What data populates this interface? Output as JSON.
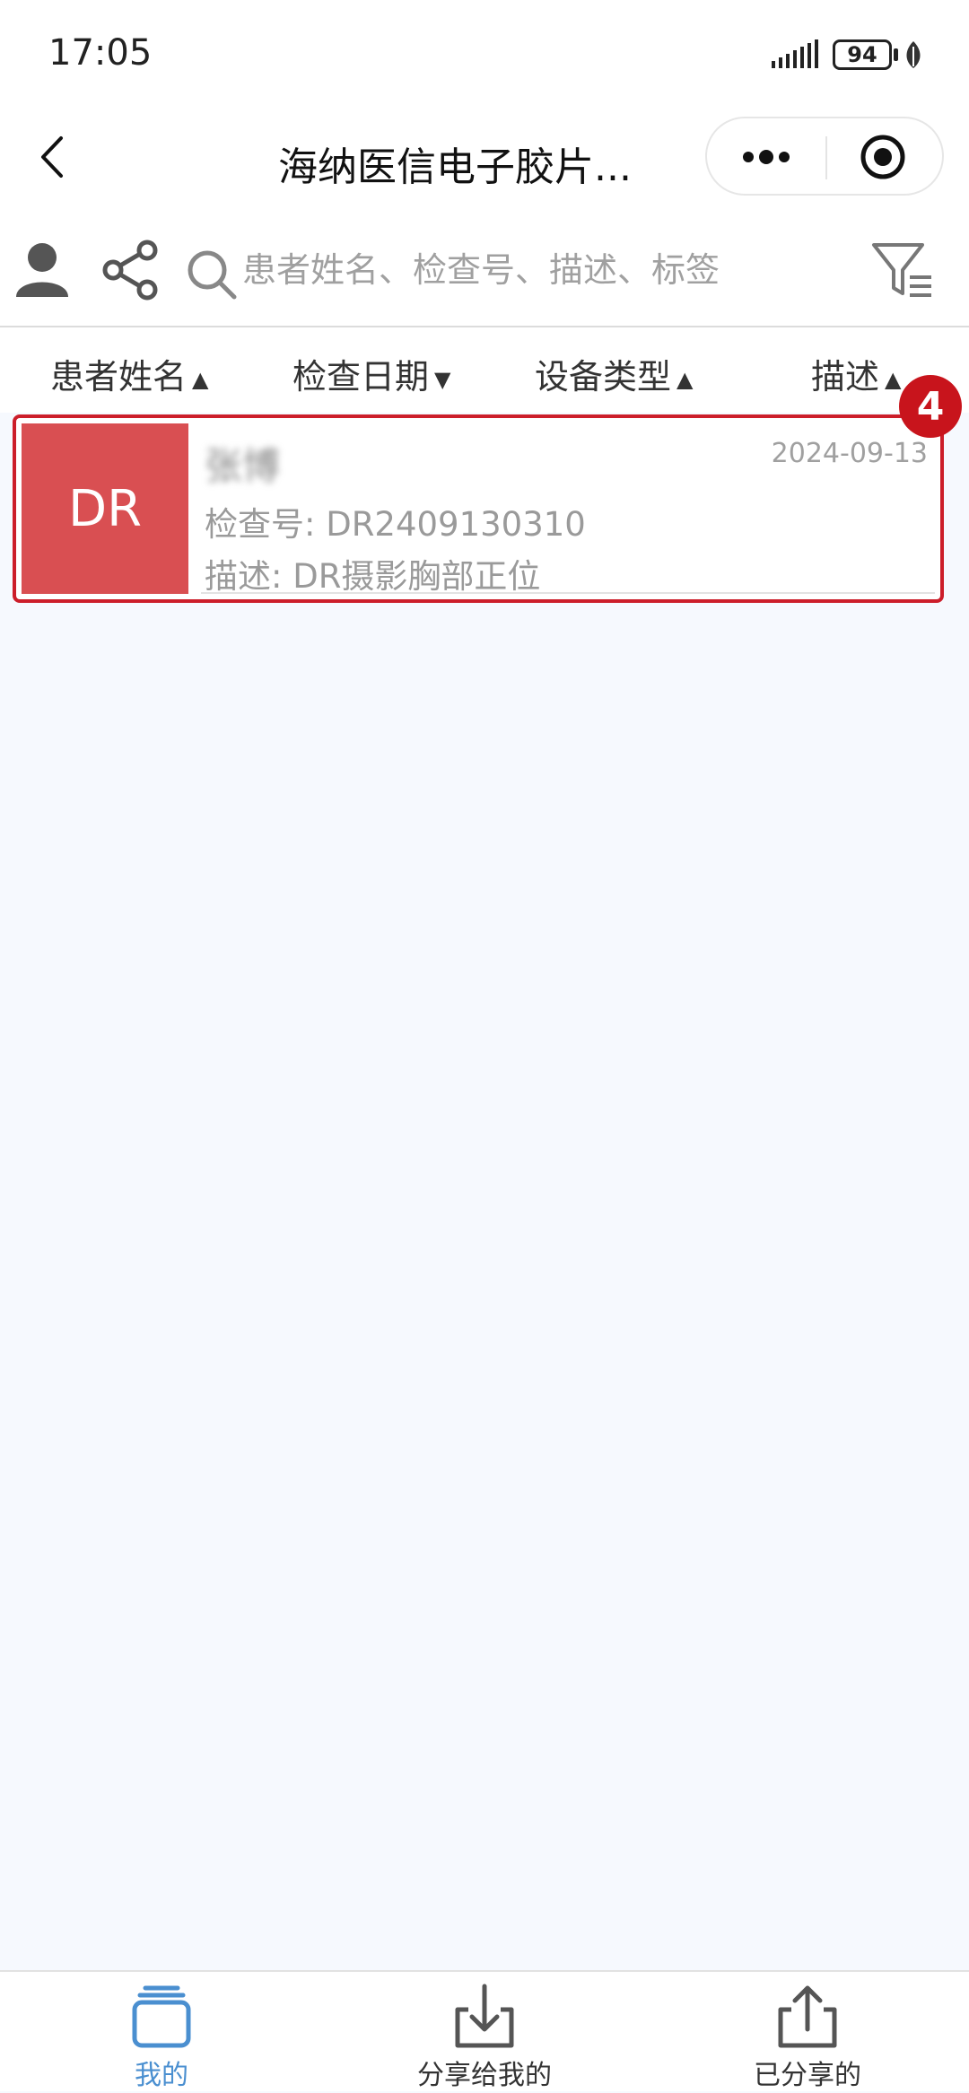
{
  "status_bar": {
    "time": "17:05",
    "battery": "94"
  },
  "nav": {
    "title": "海纳医信电子胶片..."
  },
  "toolbar": {
    "search_placeholder": "患者姓名、检查号、描述、标签"
  },
  "sort_bar": {
    "columns": [
      {
        "label": "患者姓名",
        "arrow": "▲"
      },
      {
        "label": "检查日期",
        "arrow": "▼"
      },
      {
        "label": "设备类型",
        "arrow": "▲"
      },
      {
        "label": "描述",
        "arrow": "▲"
      }
    ]
  },
  "records": [
    {
      "modality": "DR",
      "patient_name": "张博",
      "date": "2024-09-13",
      "exam_no": "检查号: DR2409130310",
      "description": "描述: DR摄影胸部正位"
    }
  ],
  "badge": "4",
  "tabs": [
    {
      "label": "我的",
      "icon": "stack-icon",
      "active": true
    },
    {
      "label": "分享给我的",
      "icon": "download-icon",
      "active": false
    },
    {
      "label": "已分享的",
      "icon": "upload-icon",
      "active": false
    }
  ],
  "colors": {
    "accent": "#4a8fd0",
    "modality_bg": "#d94f52",
    "highlight_border": "#cc1e2a",
    "background": "#f6f9fe"
  }
}
